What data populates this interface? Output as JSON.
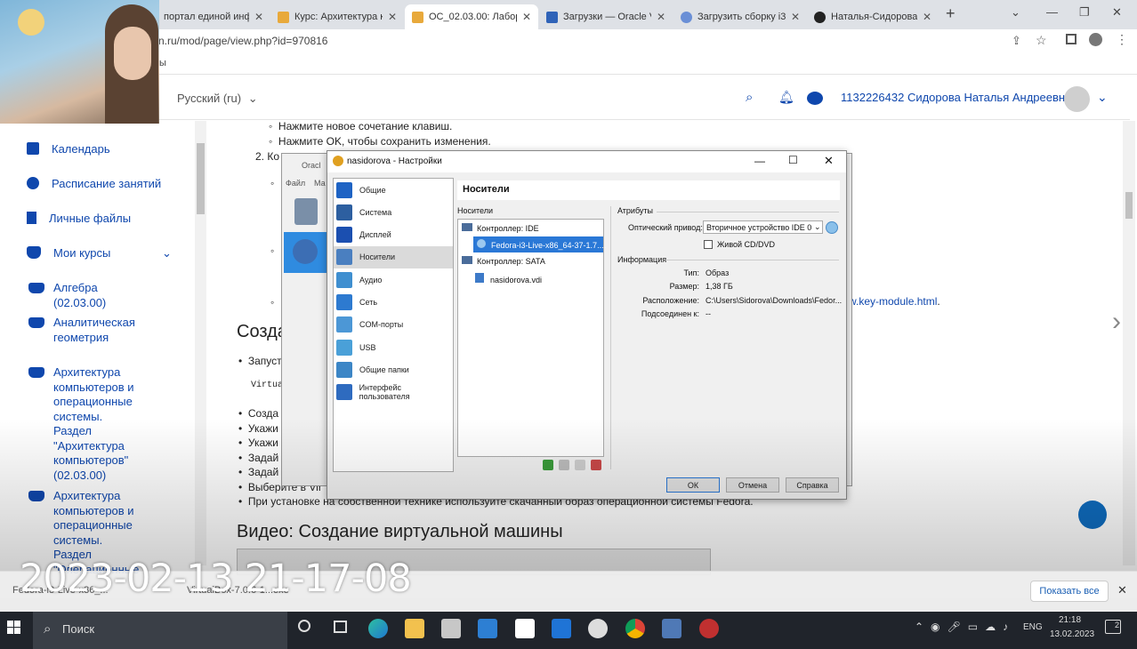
{
  "browser": {
    "tabs": [
      {
        "title": "портал единой инфо",
        "active": false
      },
      {
        "title": "Курс: Архитектура ко",
        "active": false
      },
      {
        "title": "ОС_02.03.00: Лаборато",
        "active": true
      },
      {
        "title": "Загрузки — Oracle VM",
        "active": false
      },
      {
        "title": "Загрузить сборку i3 |",
        "active": false
      },
      {
        "title": "Наталья-Сидорова/s",
        "active": false
      }
    ],
    "new_tab": "+",
    "url": "n.ru/mod/page/view.php?id=970816",
    "bookmarks_fragment": "ы"
  },
  "header": {
    "language": "Русский (ru)",
    "username": "1132226432 Сидорова Наталья Андреевна"
  },
  "sidebar": {
    "items": [
      {
        "label": "Календарь",
        "icon": "calendar-icon"
      },
      {
        "label": "Расписание занятий",
        "icon": "clock-icon"
      },
      {
        "label": "Личные файлы",
        "icon": "file-icon"
      },
      {
        "label": "Мои курсы",
        "icon": "graduation-cap-icon"
      }
    ],
    "courses": [
      {
        "label": "Алгебра (02.03.00)"
      },
      {
        "label": "Аналитическая геометрия"
      },
      {
        "label": "Архитектура компьютеров и операционные системы. Раздел \"Архитектура компьютеров\" (02.03.00)"
      },
      {
        "label": "Архитектура компьютеров и операционные системы. Раздел \"Операционные"
      }
    ]
  },
  "content": {
    "line1": "Нажмите новое сочетание клавиш.",
    "line2": "Нажмите OK, чтобы сохранить изменения.",
    "line3": "2. Ко",
    "heading_partial": "Созда",
    "bullet_start": "Запуст",
    "code_partial": "Virtua",
    "link_partial": "w.key-module.html",
    "link_suffix": ".",
    "list": [
      "Созда",
      "Укажи",
      "Укажи",
      "Задай",
      "Задай",
      "Выберите в Vir"
    ],
    "last_line": "При установке на собственной технике используйте скачанный образ операционной системы Fedora.",
    "video_heading": "Видео: Создание виртуальной машины"
  },
  "vbox_back": {
    "title_partial": "Oracl",
    "menu": [
      "Файл",
      "Ма"
    ]
  },
  "dialog": {
    "title": "nasidorova - Настройки",
    "categories": [
      {
        "label": "Общие",
        "color": "#1e63c4"
      },
      {
        "label": "Система",
        "color": "#2d5fa0"
      },
      {
        "label": "Дисплей",
        "color": "#1b4fb0"
      },
      {
        "label": "Носители",
        "color": "#4a7fc0"
      },
      {
        "label": "Аудио",
        "color": "#3f8fd0"
      },
      {
        "label": "Сеть",
        "color": "#2d7ad0"
      },
      {
        "label": "COM-порты",
        "color": "#4c97d6"
      },
      {
        "label": "USB",
        "color": "#4aa0d8"
      },
      {
        "label": "Общие папки",
        "color": "#3c86c6"
      },
      {
        "label": "Интерфейс пользователя",
        "color": "#2e6bbf"
      }
    ],
    "selected_category": "Носители",
    "page_title": "Носители",
    "storage_label": "Носители",
    "tree": [
      {
        "label": "Контроллер: IDE"
      },
      {
        "label": "Fedora-i3-Live-x86_64-37-1.7...."
      },
      {
        "label": "Контроллер: SATA"
      },
      {
        "label": "nasidorova.vdi"
      }
    ],
    "attributes_label": "Атрибуты",
    "optical_drive_label": "Оптический привод:",
    "optical_drive_value": "Вторичное устройство IDE 0",
    "live_cd_label": "Живой CD/DVD",
    "info_label": "Информация",
    "info": [
      {
        "key": "Тип:",
        "value": "Образ"
      },
      {
        "key": "Размер:",
        "value": "1,38 ГБ"
      },
      {
        "key": "Расположение:",
        "value": "C:\\Users\\Sidorova\\Downloads\\Fedor..."
      },
      {
        "key": "Подсоединен к:",
        "value": "--"
      }
    ],
    "ok": "ОК",
    "cancel": "Отмена",
    "help": "Справка"
  },
  "downloads": {
    "items": [
      "Fedora-i3-Live-x86_...",
      "VirtualBox-7.0.6-1...exe"
    ],
    "show_all": "Показать все"
  },
  "timestamp": "2023-02-13 21-17-08",
  "taskbar": {
    "search": "Поиск",
    "lang": "ENG",
    "time": "21:18",
    "date": "13.02.2023",
    "notifications": "2"
  }
}
